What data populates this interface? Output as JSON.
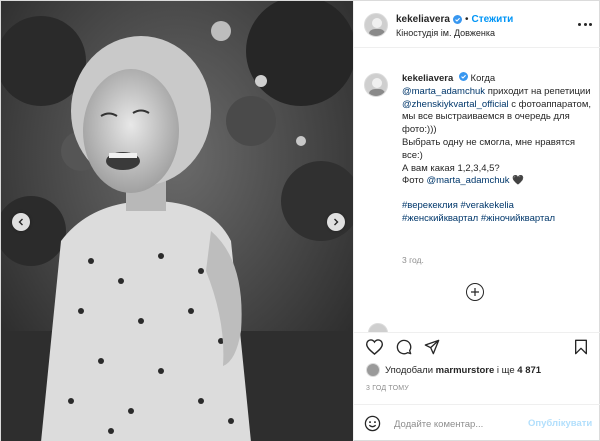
{
  "header": {
    "username": "kekeliavera",
    "separator": "•",
    "follow_label": "Стежити",
    "location": "Кіностудія ім. Довженка"
  },
  "caption": {
    "username": "kekeliavera",
    "lines": [
      {
        "type": "text",
        "text": "Когда"
      },
      {
        "type": "mention",
        "text": "@marta_adamchuk"
      },
      {
        "type": "text",
        "text": "приходит на репетиции"
      },
      {
        "type": "mention",
        "text": "@zhenskiykvartal_official"
      },
      {
        "type": "text",
        "text": "с фотоаппаратом, мы все выстраиваемся в очередь для фото:)))"
      },
      {
        "type": "text",
        "text": "Выбрать одну не смогла, мне нравятся все:)"
      },
      {
        "type": "text",
        "text": "А вам какая 1,2,3,4,5?"
      },
      {
        "type": "text",
        "text": "Фото"
      },
      {
        "type": "mention",
        "text": "@marta_adamchuk"
      },
      {
        "type": "text",
        "text": "🖤"
      }
    ],
    "hashtags": [
      "#верекеклия",
      "#verakekelia",
      "#женскийквартал",
      "#жіночийквартал"
    ],
    "time_ago": "3 год."
  },
  "likes": {
    "prefix": "Уподобали",
    "user": "marmurstore",
    "middle": "і ще",
    "count": "4 871"
  },
  "post_date": "3 ГОД ТОМУ",
  "comment_box": {
    "placeholder": "Додайте коментар...",
    "publish_label": "Опублікувати"
  },
  "icons": {
    "like": "heart-icon",
    "comment": "comment-icon",
    "share": "share-icon",
    "save": "bookmark-icon",
    "emoji": "smiley-icon",
    "more": "more-icon",
    "verified": "verified-badge-icon",
    "load_more": "plus-circle-icon"
  },
  "colors": {
    "link": "#0095f6",
    "mention": "#00376b",
    "muted": "#8e8e8e",
    "border": "#dbdbdb",
    "publish_disabled": "#b2dffc"
  }
}
